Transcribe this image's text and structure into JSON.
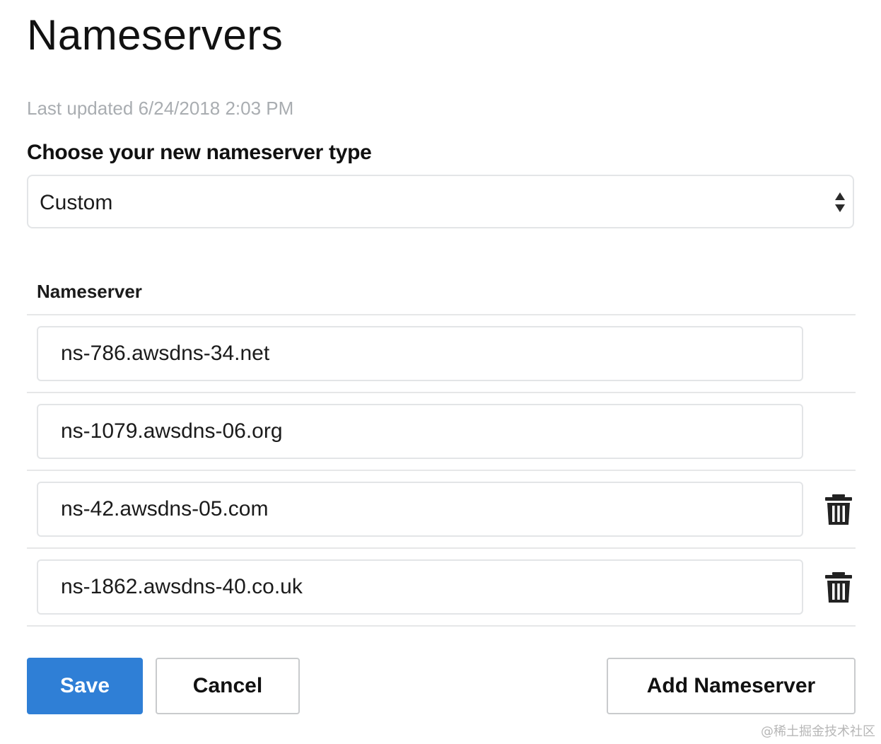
{
  "page": {
    "title": "Nameservers",
    "last_updated": "Last updated 6/24/2018 2:03 PM"
  },
  "type_selector": {
    "label": "Choose your new nameserver type",
    "selected_value": "Custom",
    "icon": "select-arrows-icon"
  },
  "table": {
    "column_header": "Nameserver",
    "rows": [
      {
        "value": "ns-786.awsdns-34.net",
        "deletable": false
      },
      {
        "value": "ns-1079.awsdns-06.org",
        "deletable": false
      },
      {
        "value": "ns-42.awsdns-05.com",
        "deletable": true
      },
      {
        "value": "ns-1862.awsdns-40.co.uk",
        "deletable": true
      }
    ],
    "delete_icon": "trash-icon"
  },
  "actions": {
    "save_label": "Save",
    "cancel_label": "Cancel",
    "add_label": "Add Nameserver"
  },
  "watermark": "@稀土掘金技术社区",
  "colors": {
    "primary": "#2f7fd6",
    "muted_text": "#a9adb1",
    "border": "#e3e5e7"
  }
}
